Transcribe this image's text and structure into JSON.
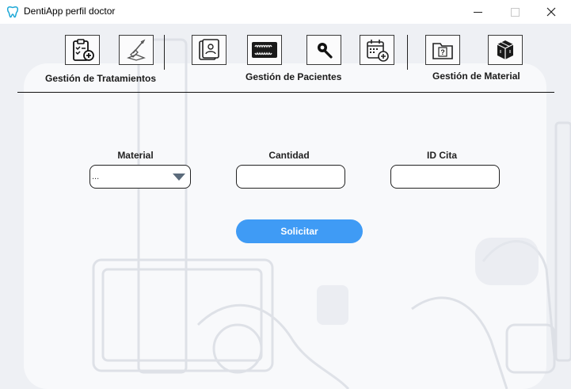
{
  "window": {
    "title": "DentiApp perfil doctor",
    "icon": "tooth-icon"
  },
  "toolbar": {
    "groups": [
      {
        "label": "Gestión de Tratamientos",
        "buttons": [
          "clipboard-plus-icon",
          "brush-icon"
        ]
      },
      {
        "label": "Gestión de Pacientes",
        "buttons": [
          "patient-file-icon",
          "teeth-xray-icon",
          "search-icon",
          "calendar-plus-icon"
        ]
      },
      {
        "label": "Gestión de Material",
        "buttons": [
          "folder-question-icon",
          "boxes-icon"
        ]
      }
    ]
  },
  "form": {
    "material": {
      "label": "Material",
      "value": "..."
    },
    "cantidad": {
      "label": "Cantidad",
      "value": ""
    },
    "id_cita": {
      "label": "ID Cita",
      "value": ""
    },
    "submit_label": "Solicitar"
  },
  "colors": {
    "accent": "#3f9bf5",
    "background": "#f4f5f8"
  }
}
